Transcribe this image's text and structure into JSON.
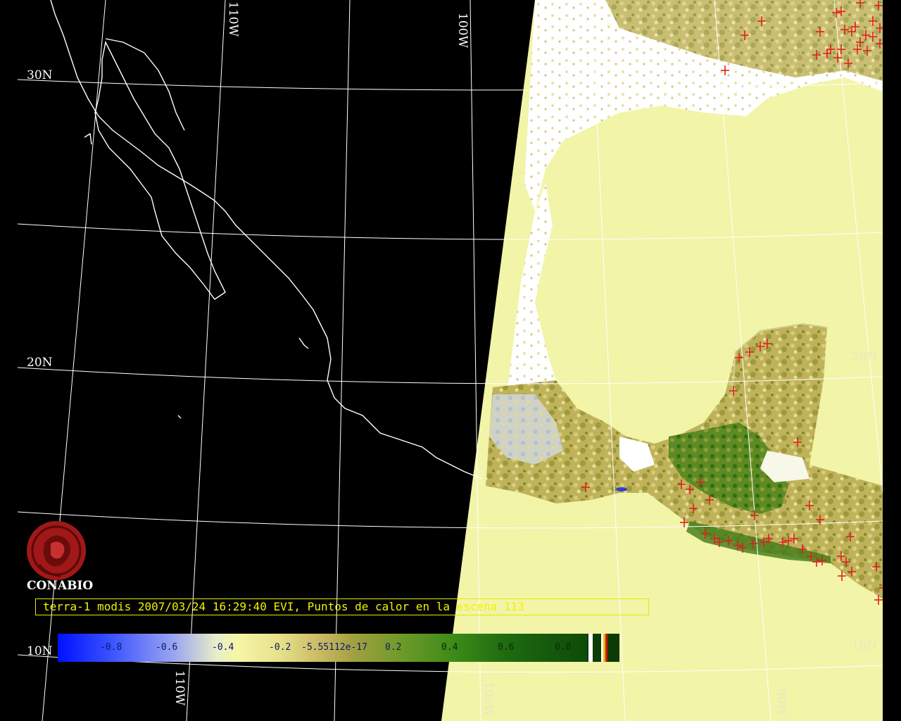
{
  "caption": "terra-1 modis 2007/03/24 16:29:40 EVI, Puntos de calor en la escena 113",
  "logo_text": "CONABIO",
  "grid_labels": {
    "lat_30n": "30N",
    "lat_20n_left": "20N",
    "lat_20n_right": "20N",
    "lat_10n_left": "10N",
    "lat_10n_right": "10N",
    "lon_110w_top": "110W",
    "lon_100w_top": "100W",
    "lon_110w_bottom": "110W",
    "lon_100w_bottom": "100W",
    "lon_90w_bottom": "90W"
  },
  "colorbar": {
    "labels": [
      "-0.8",
      "-0.6",
      "-0.4",
      "-0.2",
      "-5.55112e-17",
      "0.2",
      "0.4",
      "0.6",
      "0.8"
    ],
    "colors": {
      "low": "#0010ff",
      "mid": "#f6f6a6",
      "high": "#0e4a08"
    }
  },
  "colors": {
    "background": "#000000",
    "ocean_land_fill": "#f2f4a8",
    "coastline": "#ffffff",
    "gridline": "#ffffff",
    "fire_marker": "#e02020",
    "caption": "#f2f200"
  },
  "fire_markers_count": 113
}
